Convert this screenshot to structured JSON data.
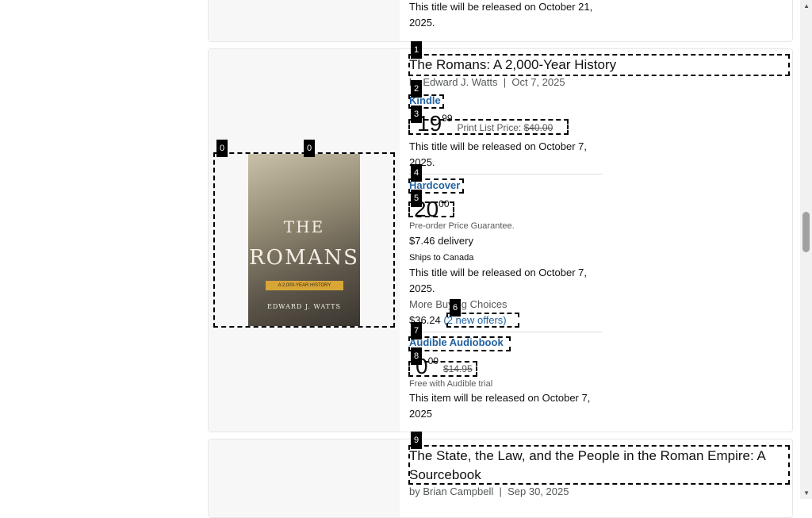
{
  "prev_item": {
    "release_text": "This title will be released on October 21, 2025."
  },
  "item1": {
    "title": "The Romans: A 2,000-Year History",
    "by": "by",
    "author": "Edward J. Watts",
    "sep": "|",
    "date": "Oct 7, 2025",
    "cover": {
      "title_line1": "THE",
      "title_line2": "ROMANS",
      "subtitle": "A 2,000-YEAR HISTORY",
      "author": "EDWARD J. WATTS"
    },
    "kindle": {
      "label": "Kindle",
      "price_whole": "19",
      "price_frac": "99",
      "list_price_label": "Print List Price:",
      "list_price": "$40.00",
      "release_text": "This title will be released on October 7, 2025."
    },
    "hardcover": {
      "label": "Hardcover",
      "price_whole": "20",
      "price_frac": "00",
      "guarantee": "Pre-order Price Guarantee.",
      "delivery": "$7.46 delivery",
      "ships": "Ships to Canada",
      "release_text": "This title will be released on October 7, 2025.",
      "more_choices": "More Buying Choices",
      "offer_price": "$36.24",
      "offers_link": "(2 new offers)"
    },
    "audible": {
      "label": "Audible Audiobook",
      "price_whole": "0",
      "price_frac": "00",
      "list_price": "$14.95",
      "trial": "Free with Audible trial",
      "release_text": "This item will be released on October 7, 2025"
    }
  },
  "item2": {
    "title": "The State, the Law, and the People in the Roman Empire: A Sourcebook",
    "by": "by",
    "author": "Brian Campbell",
    "sep": "|",
    "date": "Sep 30, 2025"
  },
  "overlay_tags": [
    "0",
    "0",
    "1",
    "2",
    "3",
    "4",
    "5",
    "6",
    "7",
    "8",
    "9"
  ]
}
